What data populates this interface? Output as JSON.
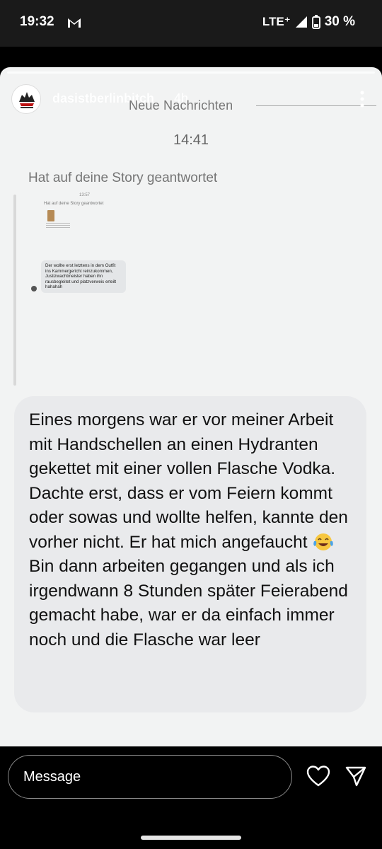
{
  "status_bar": {
    "time": "19:32",
    "network": "LTE⁺",
    "battery": "30 %",
    "mail_icon": "gmail-icon"
  },
  "story": {
    "username": "dasistberlinbitch",
    "time_ago": "4h",
    "new_messages_label": "Neue Nachrichten",
    "timestamp": "14:41",
    "replied_label": "Hat auf deine Story geantwortet",
    "nested": {
      "timestamp": "13:57",
      "replied_label": "Hat auf deine Story geantwortet",
      "message": "Der wollte erst letztens in dem Outfit ins Kammergericht reinzukommen, Justizwachtmeister haben ihn rausbegleitet und platzverweis erteilt hahahah"
    },
    "message": "Eines morgens war er vor meiner Arbeit mit Handschellen an einen Hydranten gekettet mit einer vollen Flasche Vodka. Dachte erst, dass er vom Feiern kommt oder sowas und wollte helfen, kannte den vorher nicht. Er hat mich angefaucht ",
    "message_part2": "\nBin dann arbeiten gegangen und als ich irgendwann 8 Stunden später Feierabend gemacht habe, war er da einfach immer noch und die Flasche war leer"
  },
  "reply_bar": {
    "placeholder": "Message"
  }
}
